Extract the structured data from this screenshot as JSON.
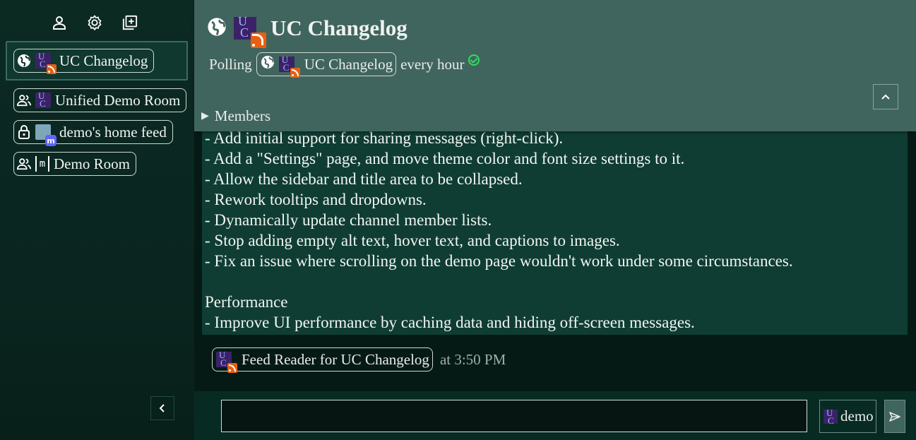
{
  "sidebar": {
    "toolbar": [
      "person-icon",
      "gear-icon",
      "add-room-icon"
    ],
    "rooms": [
      {
        "label": "UC Changelog",
        "protocol_icon": "globe-icon",
        "avatar": "uc-rss-avatar",
        "selected": true
      },
      {
        "label": "Unified Demo Room",
        "protocol_icon": "group-icon",
        "avatar": "uc-avatar",
        "selected": false
      },
      {
        "label": "demo's home feed",
        "protocol_icon": "lock-icon",
        "avatar": "mastodon-avatar",
        "selected": false
      },
      {
        "label": "Demo Room",
        "protocol_icon": "group-icon",
        "avatar": "matrix-avatar",
        "selected": false
      }
    ]
  },
  "header": {
    "title": "UC Changelog",
    "polling_prefix": "Polling",
    "polling_chip": "UC Changelog",
    "polling_suffix": "every hour",
    "members_label": "Members"
  },
  "message": {
    "lines": [
      "- Add initial support for sharing messages (right-click).",
      "- Add a \"Settings\" page, and move theme color and font size settings to it.",
      "- Allow the sidebar and title area to be collapsed.",
      "- Rework tooltips and dropdowns.",
      "- Dynamically update channel member lists.",
      "- Stop adding empty alt text, hover text, and captions to images.",
      "- Fix an issue where scrolling on the demo page wouldn't work under some circumstances.",
      "",
      "Performance",
      "- Improve UI performance by caching data and hiding off-screen messages."
    ],
    "author": "Feed Reader for UC Changelog",
    "time": "at 3:50 PM"
  },
  "composer": {
    "placeholder": "",
    "identity": "demo"
  },
  "colors": {
    "header_bg": "#40655e",
    "message_bg": "#0f3d33",
    "rss_orange": "#e8600f",
    "status_green": "#2ee05a"
  }
}
